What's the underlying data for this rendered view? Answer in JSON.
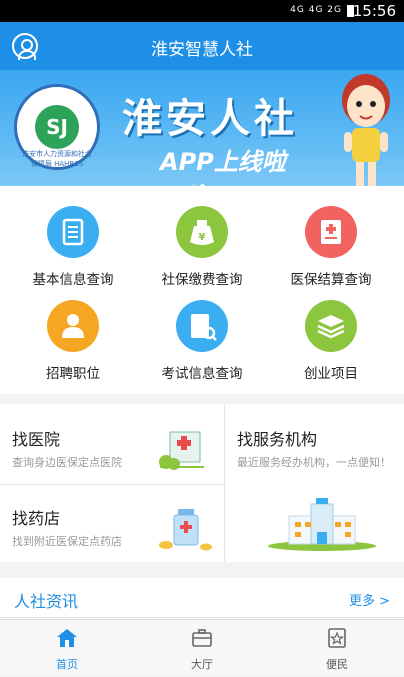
{
  "status_bar": {
    "network": "4G 4G 2G",
    "time": "15:56"
  },
  "app_bar": {
    "title": "淮安智慧人社"
  },
  "banner": {
    "headline": "淮安人社",
    "subtitle": "APP上线啦",
    "logo_text": "淮安市人力资源和社会保障局 HAHRSS"
  },
  "services": [
    {
      "label": "基本信息查询",
      "icon": "list-icon",
      "color": "#3aaef0"
    },
    {
      "label": "社保缴费查询",
      "icon": "money-bag-icon",
      "color": "#8cc63f"
    },
    {
      "label": "医保结算查询",
      "icon": "medical-plus-icon",
      "color": "#f2635f"
    },
    {
      "label": "招聘职位",
      "icon": "person-icon",
      "color": "#f5a623"
    },
    {
      "label": "考试信息查询",
      "icon": "document-search-icon",
      "color": "#3aaef0"
    },
    {
      "label": "创业项目",
      "icon": "layers-icon",
      "color": "#8cc63f"
    }
  ],
  "finders": {
    "hospital": {
      "title": "找医院",
      "desc": "查询身边医保定点医院"
    },
    "pharmacy": {
      "title": "找药店",
      "desc": "找到附近医保定点药店"
    },
    "agency": {
      "title": "找服务机构",
      "desc": "最近服务经办机构，一点便知！"
    }
  },
  "news": {
    "title": "人社资讯",
    "more": "更多 >"
  },
  "tabs": [
    {
      "label": "首页",
      "icon": "home-icon",
      "active": true
    },
    {
      "label": "大厅",
      "icon": "briefcase-icon",
      "active": false
    },
    {
      "label": "便民",
      "icon": "star-icon",
      "active": false
    }
  ],
  "colors": {
    "primary": "#1e8fe6",
    "banner": "#3aa6f0"
  }
}
